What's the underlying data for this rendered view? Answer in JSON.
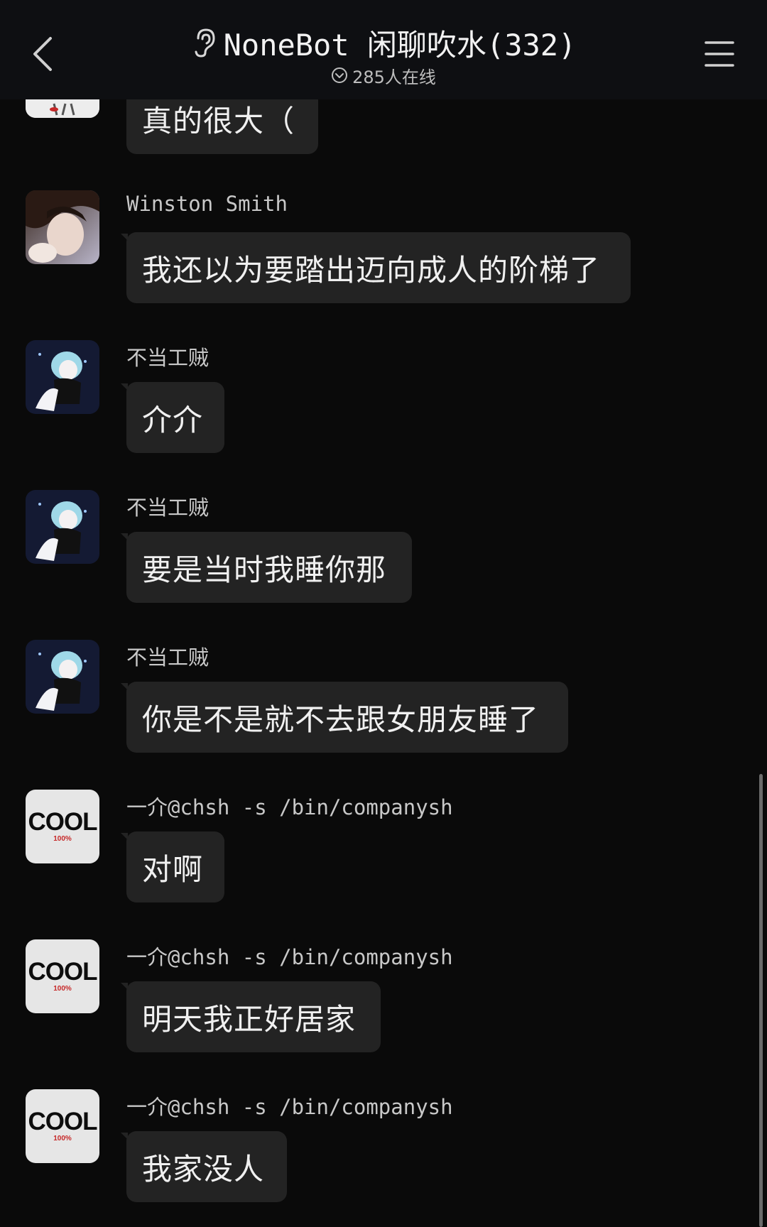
{
  "header": {
    "title": "NoneBot 闲聊吹水(332)",
    "online": "285人在线"
  },
  "messages": [
    {
      "sender": "",
      "text": "真的很大（",
      "avatar": "girl-avatar"
    },
    {
      "sender": "Winston Smith",
      "text": "我还以为要踏出迈向成人的阶梯了",
      "avatar": "anime-boy-avatar"
    },
    {
      "sender": "不当工贼",
      "text": "介介",
      "avatar": "anime-gem-girl-avatar"
    },
    {
      "sender": "不当工贼",
      "text": "要是当时我睡你那",
      "avatar": "anime-gem-girl-avatar"
    },
    {
      "sender": "不当工贼",
      "text": "你是不是就不去跟女朋友睡了",
      "avatar": "anime-gem-girl-avatar"
    },
    {
      "sender": "一介@chsh -s /bin/companysh",
      "text": "对啊",
      "avatar": "cool-avatar"
    },
    {
      "sender": "一介@chsh -s /bin/companysh",
      "text": "明天我正好居家",
      "avatar": "cool-avatar"
    },
    {
      "sender": "一介@chsh -s /bin/companysh",
      "text": "我家没人",
      "avatar": "cool-avatar"
    }
  ],
  "cool_avatar": {
    "word": "COOL",
    "percent": "100%"
  },
  "colors": {
    "background": "#0a0a0a",
    "header": "#0e0f12",
    "bubble": "#232323",
    "text": "#f0f0f0",
    "accent_red": "#c62828"
  }
}
